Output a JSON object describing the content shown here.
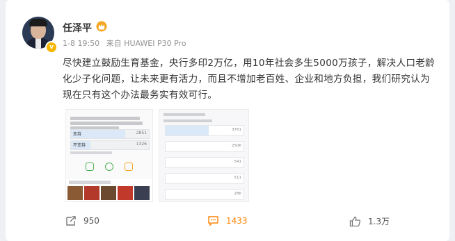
{
  "user": {
    "name": "任泽平",
    "verified_mark": "v"
  },
  "meta": {
    "time": "1-8 19:50",
    "source": "来自 HUAWEI P30 Pro"
  },
  "post": {
    "text": "尽快建立鼓励生育基金，央行多印2万亿，用10年社会多生5000万孩子，解决人口老龄化少子化问题，让未来更有活力，而且不增加老百姓、企业和地方负担，我们研究认为现在只有这个办法最务实有效可行。"
  },
  "image_left": {
    "options": [
      {
        "label": "支持",
        "value": "2851",
        "share": 0.7
      },
      {
        "label": "不支持",
        "value": "1326",
        "share": 0.25
      }
    ]
  },
  "image_right": {
    "options": [
      {
        "value": "3761",
        "share": 0.55
      },
      {
        "value": "2506",
        "share": 0
      },
      {
        "value": "541",
        "share": 0
      },
      {
        "value": "511",
        "share": 0
      },
      {
        "value": "286",
        "share": 0
      }
    ]
  },
  "actions": {
    "repost_count": "950",
    "comment_count": "1433",
    "like_count": "1.3万"
  },
  "colors": {
    "accent": "#ff8200",
    "text": "#333333",
    "meta": "#939393",
    "background": "#eef0f3"
  },
  "icons": [
    "avatar",
    "crown-badge-icon",
    "verified-icon",
    "repost-icon",
    "comment-icon",
    "like-icon"
  ]
}
